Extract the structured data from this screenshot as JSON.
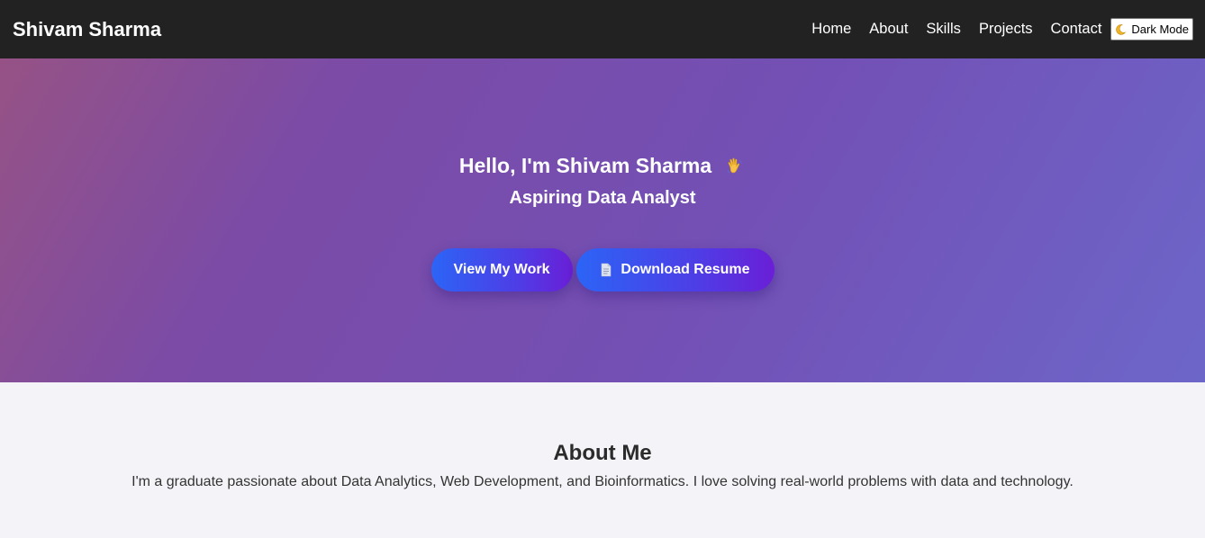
{
  "nav": {
    "brand": "Shivam Sharma",
    "links": [
      "Home",
      "About",
      "Skills",
      "Projects",
      "Contact"
    ],
    "dark_mode_label": "Dark Mode",
    "dark_mode_icon": "moon-icon"
  },
  "hero": {
    "title": "Hello, I'm Shivam Sharma",
    "title_icon": "waving-hand-icon",
    "subtitle": "Aspiring Data Analyst",
    "primary_button": "View My Work",
    "secondary_button": "Download Resume",
    "secondary_button_icon": "document-icon"
  },
  "about": {
    "heading": "About Me",
    "text": "I'm a graduate passionate about Data Analytics, Web Development, and Bioinformatics. I love solving real-world problems with data and technology."
  },
  "colors": {
    "navbar_bg": "#222222",
    "hero_gradient_start": "#965285",
    "hero_gradient_end": "#6d66c9",
    "button_gradient_start": "#2c64f6",
    "button_gradient_end": "#6a1fd6",
    "page_bg": "#f4f4f8"
  }
}
